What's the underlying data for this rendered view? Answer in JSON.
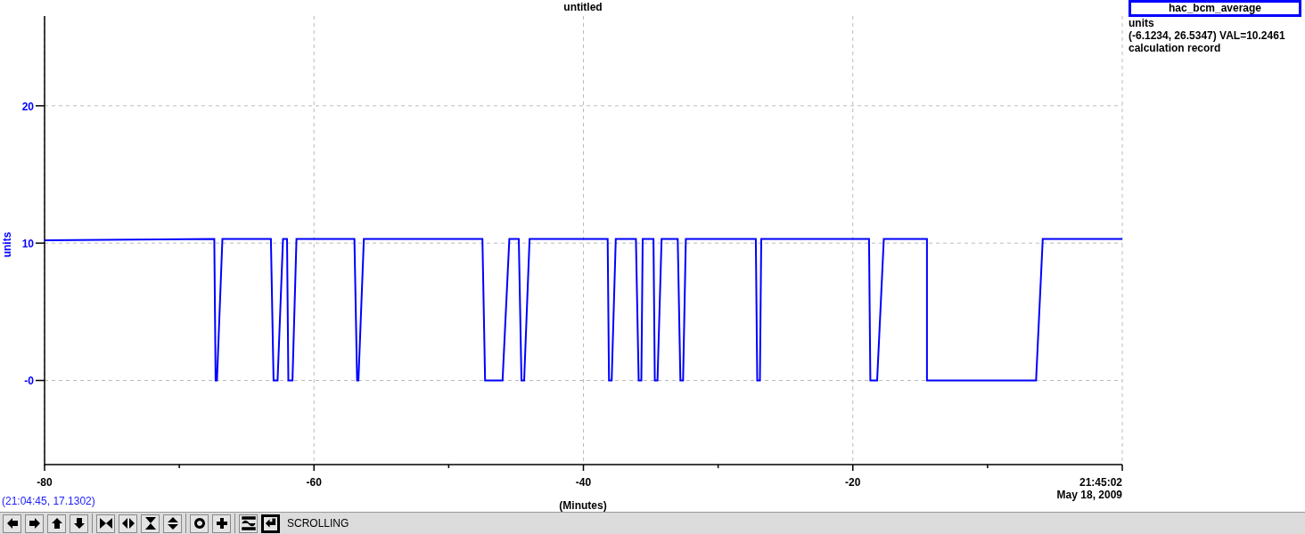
{
  "plot": {
    "chart_data": {
      "type": "line",
      "title": "untitled",
      "xlabel": "(Minutes)",
      "ylabel": "units",
      "x": [
        -80,
        -67.4,
        -67.3,
        -67.2,
        -66.8,
        -63.2,
        -63.0,
        -62.7,
        -62.3,
        -62.0,
        -61.9,
        -61.6,
        -61.3,
        -57.0,
        -56.8,
        -56.7,
        -56.3,
        -47.5,
        -47.3,
        -46.0,
        -45.5,
        -44.8,
        -44.6,
        -44.4,
        -44.0,
        -38.2,
        -38.1,
        -37.9,
        -37.6,
        -36.1,
        -35.9,
        -35.7,
        -35.6,
        -34.8,
        -34.7,
        -34.5,
        -34.2,
        -33.0,
        -32.8,
        -32.6,
        -32.4,
        -27.2,
        -27.1,
        -26.9,
        -26.8,
        -18.8,
        -18.7,
        -18.2,
        -17.7,
        -14.5,
        -14.5,
        -6.4,
        -5.9,
        0
      ],
      "series": [
        {
          "name": "hac_bcm_average",
          "color": "#0000ff",
          "values": [
            10.2,
            10.3,
            0,
            0,
            10.3,
            10.3,
            0,
            0,
            10.3,
            10.3,
            0,
            0,
            10.3,
            10.3,
            0,
            0,
            10.3,
            10.3,
            0,
            0,
            10.3,
            10.3,
            0,
            0,
            10.3,
            10.3,
            0,
            0,
            10.3,
            10.3,
            0,
            0,
            10.3,
            10.3,
            0,
            0,
            10.3,
            10.3,
            0,
            0,
            10.3,
            10.3,
            0,
            0,
            10.3,
            10.3,
            0,
            0,
            10.3,
            10.3,
            0,
            0,
            10.3,
            10.3
          ]
        }
      ],
      "xlim": [
        -80,
        0
      ],
      "ylim": [
        -6.1234,
        26.5347
      ],
      "xticks": [
        -80,
        -60,
        -40,
        -20
      ],
      "grid": true,
      "yticks": [
        {
          "value": 0,
          "label": "-0"
        },
        10,
        20
      ]
    },
    "end_time": "21:45:02",
    "date": "May 18, 2009",
    "cursor_readout": "(21:04:45, 17.1302)"
  },
  "legend": {
    "units": "units",
    "range": "(-6.1234, 26.5347) VAL=10.2461",
    "description": "calculation record"
  },
  "toolbar": {
    "groups": [
      [
        {
          "selected": false
        },
        {
          "selected": false
        },
        {
          "selected": false
        },
        {
          "selected": false
        }
      ],
      [
        {
          "selected": false
        },
        {
          "selected": false
        },
        {
          "selected": false
        },
        {
          "selected": false
        }
      ],
      [
        {
          "selected": false
        },
        {
          "selected": false
        }
      ],
      [
        {
          "selected": false
        },
        {
          "selected": true
        }
      ]
    ],
    "mode": "SCROLLING"
  }
}
